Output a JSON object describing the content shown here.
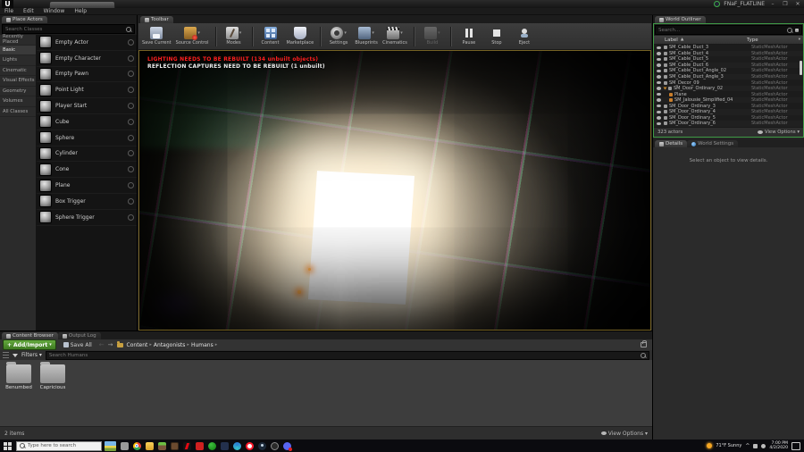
{
  "window": {
    "title": "FNaF_FLATLINE",
    "menu": [
      "File",
      "Edit",
      "Window",
      "Help"
    ]
  },
  "place_actors": {
    "tab": "Place Actors",
    "search_placeholder": "Search Classes",
    "active_category": "Basic",
    "categories": [
      "Recently Placed",
      "Basic",
      "Lights",
      "Cinematic",
      "Visual Effects",
      "Geometry",
      "Volumes",
      "All Classes"
    ],
    "items": [
      "Empty Actor",
      "Empty Character",
      "Empty Pawn",
      "Point Light",
      "Player Start",
      "Cube",
      "Sphere",
      "Cylinder",
      "Cone",
      "Plane",
      "Box Trigger",
      "Sphere Trigger"
    ]
  },
  "toolbar": {
    "tab": "Toolbar",
    "buttons": [
      {
        "label": "Save Current",
        "name": "save-current",
        "dropdown": false,
        "disabled": false
      },
      {
        "label": "Source Control",
        "name": "source-control",
        "dropdown": true,
        "disabled": false
      },
      {
        "label": "Modes",
        "name": "modes",
        "dropdown": true,
        "disabled": false
      },
      {
        "label": "Content",
        "name": "content",
        "dropdown": false,
        "disabled": false
      },
      {
        "label": "Marketplace",
        "name": "marketplace",
        "dropdown": false,
        "disabled": false
      },
      {
        "label": "Settings",
        "name": "settings",
        "dropdown": true,
        "disabled": false
      },
      {
        "label": "Blueprints",
        "name": "blueprints",
        "dropdown": true,
        "disabled": false
      },
      {
        "label": "Cinematics",
        "name": "cinematics",
        "dropdown": true,
        "disabled": false
      },
      {
        "label": "Build",
        "name": "build",
        "dropdown": true,
        "disabled": true
      },
      {
        "label": "Pause",
        "name": "pause",
        "dropdown": false,
        "disabled": false
      },
      {
        "label": "Stop",
        "name": "stop",
        "dropdown": false,
        "disabled": false
      },
      {
        "label": "Eject",
        "name": "eject",
        "dropdown": false,
        "disabled": false
      }
    ]
  },
  "viewport": {
    "warning_lighting": "LIGHTING NEEDS TO BE REBUILT (134 unbuilt objects)",
    "warning_reflection": "REFLECTION CAPTURES NEED TO BE REBUILT (1 unbuilt)"
  },
  "world_outliner": {
    "tab": "World Outliner",
    "search_placeholder": "Search...",
    "columns": [
      "Label",
      "Type"
    ],
    "rows": [
      {
        "label": "SM_Cable_Duct_3",
        "type": "StaticMeshActor",
        "indent": 0,
        "expanded": false,
        "child": false
      },
      {
        "label": "SM_Cable_Duct_4",
        "type": "StaticMeshActor",
        "indent": 0,
        "expanded": false,
        "child": false
      },
      {
        "label": "SM_Cable_Duct_5",
        "type": "StaticMeshActor",
        "indent": 0,
        "expanded": false,
        "child": false
      },
      {
        "label": "SM_Cable_Duct_6",
        "type": "StaticMeshActor",
        "indent": 0,
        "expanded": false,
        "child": false
      },
      {
        "label": "SM_Cable_Duct_Angle_02",
        "type": "StaticMeshActor",
        "indent": 0,
        "expanded": false,
        "child": false
      },
      {
        "label": "SM_Cable_Duct_Angle_3",
        "type": "StaticMeshActor",
        "indent": 0,
        "expanded": false,
        "child": false
      },
      {
        "label": "SM_Decor_09",
        "type": "StaticMeshActor",
        "indent": 0,
        "expanded": false,
        "child": false
      },
      {
        "label": "SM_Door_Ordinary_02",
        "type": "StaticMeshActor",
        "indent": 0,
        "expanded": true,
        "child": false
      },
      {
        "label": "Plane",
        "type": "StaticMeshActor",
        "indent": 1,
        "expanded": false,
        "child": true
      },
      {
        "label": "SM_Jalousie_Simplified_04",
        "type": "StaticMeshActor",
        "indent": 1,
        "expanded": false,
        "child": true
      },
      {
        "label": "SM_Door_Ordinary_3",
        "type": "StaticMeshActor",
        "indent": 0,
        "expanded": false,
        "child": false
      },
      {
        "label": "SM_Door_Ordinary_4",
        "type": "StaticMeshActor",
        "indent": 0,
        "expanded": false,
        "child": false
      },
      {
        "label": "SM_Door_Ordinary_5",
        "type": "StaticMeshActor",
        "indent": 0,
        "expanded": false,
        "child": false
      },
      {
        "label": "SM_Door_Ordinary_6",
        "type": "StaticMeshActor",
        "indent": 0,
        "expanded": false,
        "child": false
      }
    ],
    "footer": {
      "count": "323 actors",
      "view_options": "View Options"
    }
  },
  "details": {
    "tab_details": "Details",
    "tab_world_settings": "World Settings",
    "empty_text": "Select an object to view details."
  },
  "content_browser": {
    "tab_content": "Content Browser",
    "tab_output": "Output Log",
    "add_import": "Add/Import",
    "save_all": "Save All",
    "breadcrumb": [
      "Content",
      "Antagonists",
      "Humans"
    ],
    "filters": "Filters",
    "search_placeholder": "Search Humans",
    "folders": [
      "Benumbed",
      "Capricious"
    ],
    "status": "2 items",
    "view_options": "View Options"
  },
  "taskbar": {
    "search_placeholder": "Type here to search",
    "apps": [
      "grey-app",
      "chrome",
      "file-explorer",
      "minecraft",
      "crafting-table",
      "netflix",
      "red-app",
      "xbox",
      "dark-app",
      "edge",
      "opera",
      "steam",
      "ring-app",
      "discord"
    ],
    "weather": "71°F Sunny",
    "time": "7:00 PM",
    "date": "4/2/2020"
  },
  "colors": {
    "outliner_focus_green": "#3f9b46",
    "add_import_green": "#4c8b2f",
    "warning_red": "#ff2020",
    "viewport_border": "#756224"
  }
}
